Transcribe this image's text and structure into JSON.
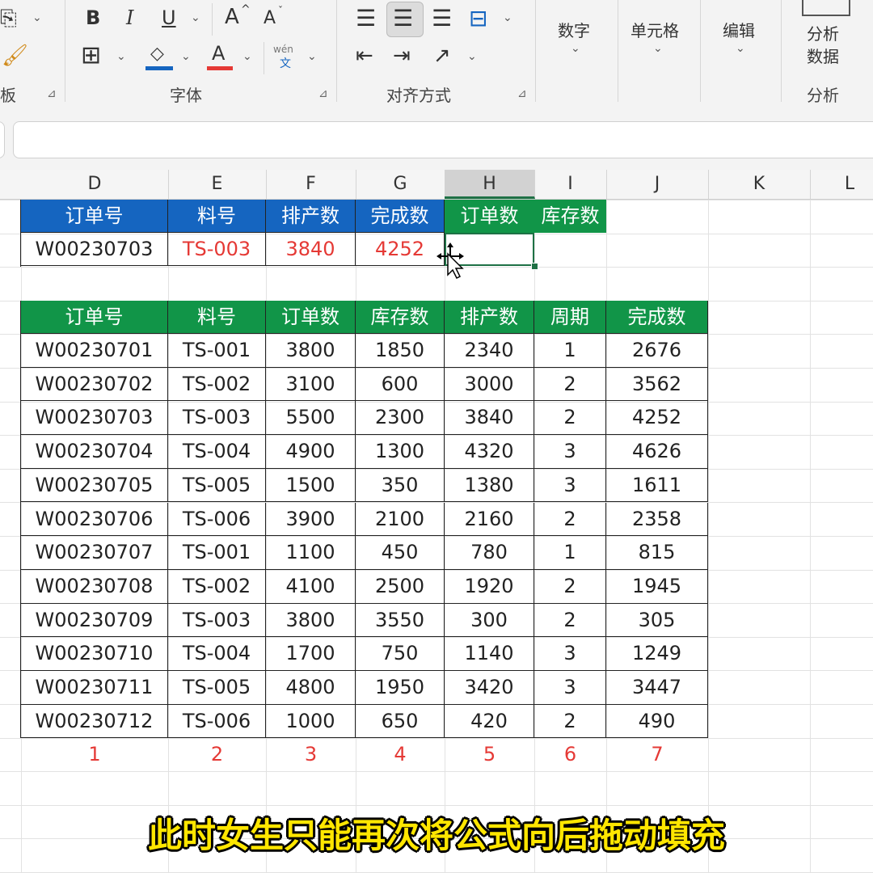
{
  "ribbon": {
    "font_group_label": "字体",
    "align_group_label": "对齐方式",
    "clipboard_group_label_partial": "板",
    "analysis_group_label": "分析",
    "number_button": "数字",
    "cell_button": "单元格",
    "edit_button": "编辑",
    "analyze_data_button_line1": "分析",
    "analyze_data_button_line2": "数据",
    "bold": "B",
    "italic": "I",
    "underline": "U",
    "increase_font": "A",
    "decrease_font": "A",
    "phonetic_top": "wén",
    "phonetic_bottom": "文"
  },
  "columns": [
    "D",
    "E",
    "F",
    "G",
    "H",
    "I",
    "J",
    "K",
    "L"
  ],
  "lookup_table": {
    "headers": [
      "订单号",
      "料号",
      "排产数",
      "完成数",
      "订单数",
      "库存数"
    ],
    "row": [
      "W00230703",
      "TS-003",
      "3840",
      "4252",
      "",
      ""
    ]
  },
  "data_table": {
    "headers": [
      "订单号",
      "料号",
      "订单数",
      "库存数",
      "排产数",
      "周期",
      "完成数"
    ],
    "rows": [
      [
        "W00230701",
        "TS-001",
        "3800",
        "1850",
        "2340",
        "1",
        "2676"
      ],
      [
        "W00230702",
        "TS-002",
        "3100",
        "600",
        "3000",
        "2",
        "3562"
      ],
      [
        "W00230703",
        "TS-003",
        "5500",
        "2300",
        "3840",
        "2",
        "4252"
      ],
      [
        "W00230704",
        "TS-004",
        "4900",
        "1300",
        "4320",
        "3",
        "4626"
      ],
      [
        "W00230705",
        "TS-005",
        "1500",
        "350",
        "1380",
        "3",
        "1611"
      ],
      [
        "W00230706",
        "TS-006",
        "3900",
        "2100",
        "2160",
        "2",
        "2358"
      ],
      [
        "W00230707",
        "TS-001",
        "1100",
        "450",
        "780",
        "1",
        "815"
      ],
      [
        "W00230708",
        "TS-002",
        "4100",
        "2500",
        "1920",
        "2",
        "1945"
      ],
      [
        "W00230709",
        "TS-003",
        "3800",
        "3550",
        "300",
        "2",
        "305"
      ],
      [
        "W00230710",
        "TS-004",
        "1700",
        "750",
        "1140",
        "3",
        "1249"
      ],
      [
        "W00230711",
        "TS-005",
        "4800",
        "1950",
        "3420",
        "3",
        "3447"
      ],
      [
        "W00230712",
        "TS-006",
        "1000",
        "650",
        "420",
        "2",
        "490"
      ]
    ],
    "index_row": [
      "1",
      "2",
      "3",
      "4",
      "5",
      "6",
      "7"
    ]
  },
  "caption": "此时女生只能再次将公式向后拖动填充",
  "colors": {
    "header_blue": "#1565c0",
    "header_green": "#119548",
    "highlight_red": "#e53935",
    "caption_yellow": "#ffe600",
    "selection_green": "#1e7145"
  }
}
